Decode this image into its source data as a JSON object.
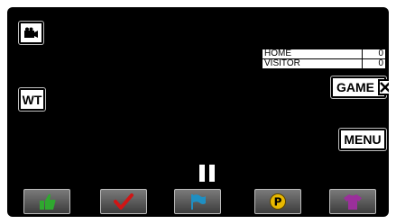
{
  "buttons": {
    "wt_label": "WT",
    "game_label": "GAME",
    "menu_label": "MENU",
    "game_close_icon": "close-x-icon",
    "rec_icon": "video-camera-icon"
  },
  "scoreboard": {
    "rows": [
      {
        "team": "HOME",
        "score": "0"
      },
      {
        "team": "VISITOR",
        "score": "0"
      }
    ]
  },
  "playback": {
    "icon": "pause-icon"
  },
  "tags": [
    {
      "icon": "thumbs-up-icon",
      "color": "#2fa82f"
    },
    {
      "icon": "checkmark-icon",
      "color": "#d01515"
    },
    {
      "icon": "flag-icon",
      "color": "#1f8fc2"
    },
    {
      "icon": "p-badge-icon",
      "color": "#e8b800"
    },
    {
      "icon": "shirt-icon",
      "color": "#9b2f9b"
    }
  ]
}
